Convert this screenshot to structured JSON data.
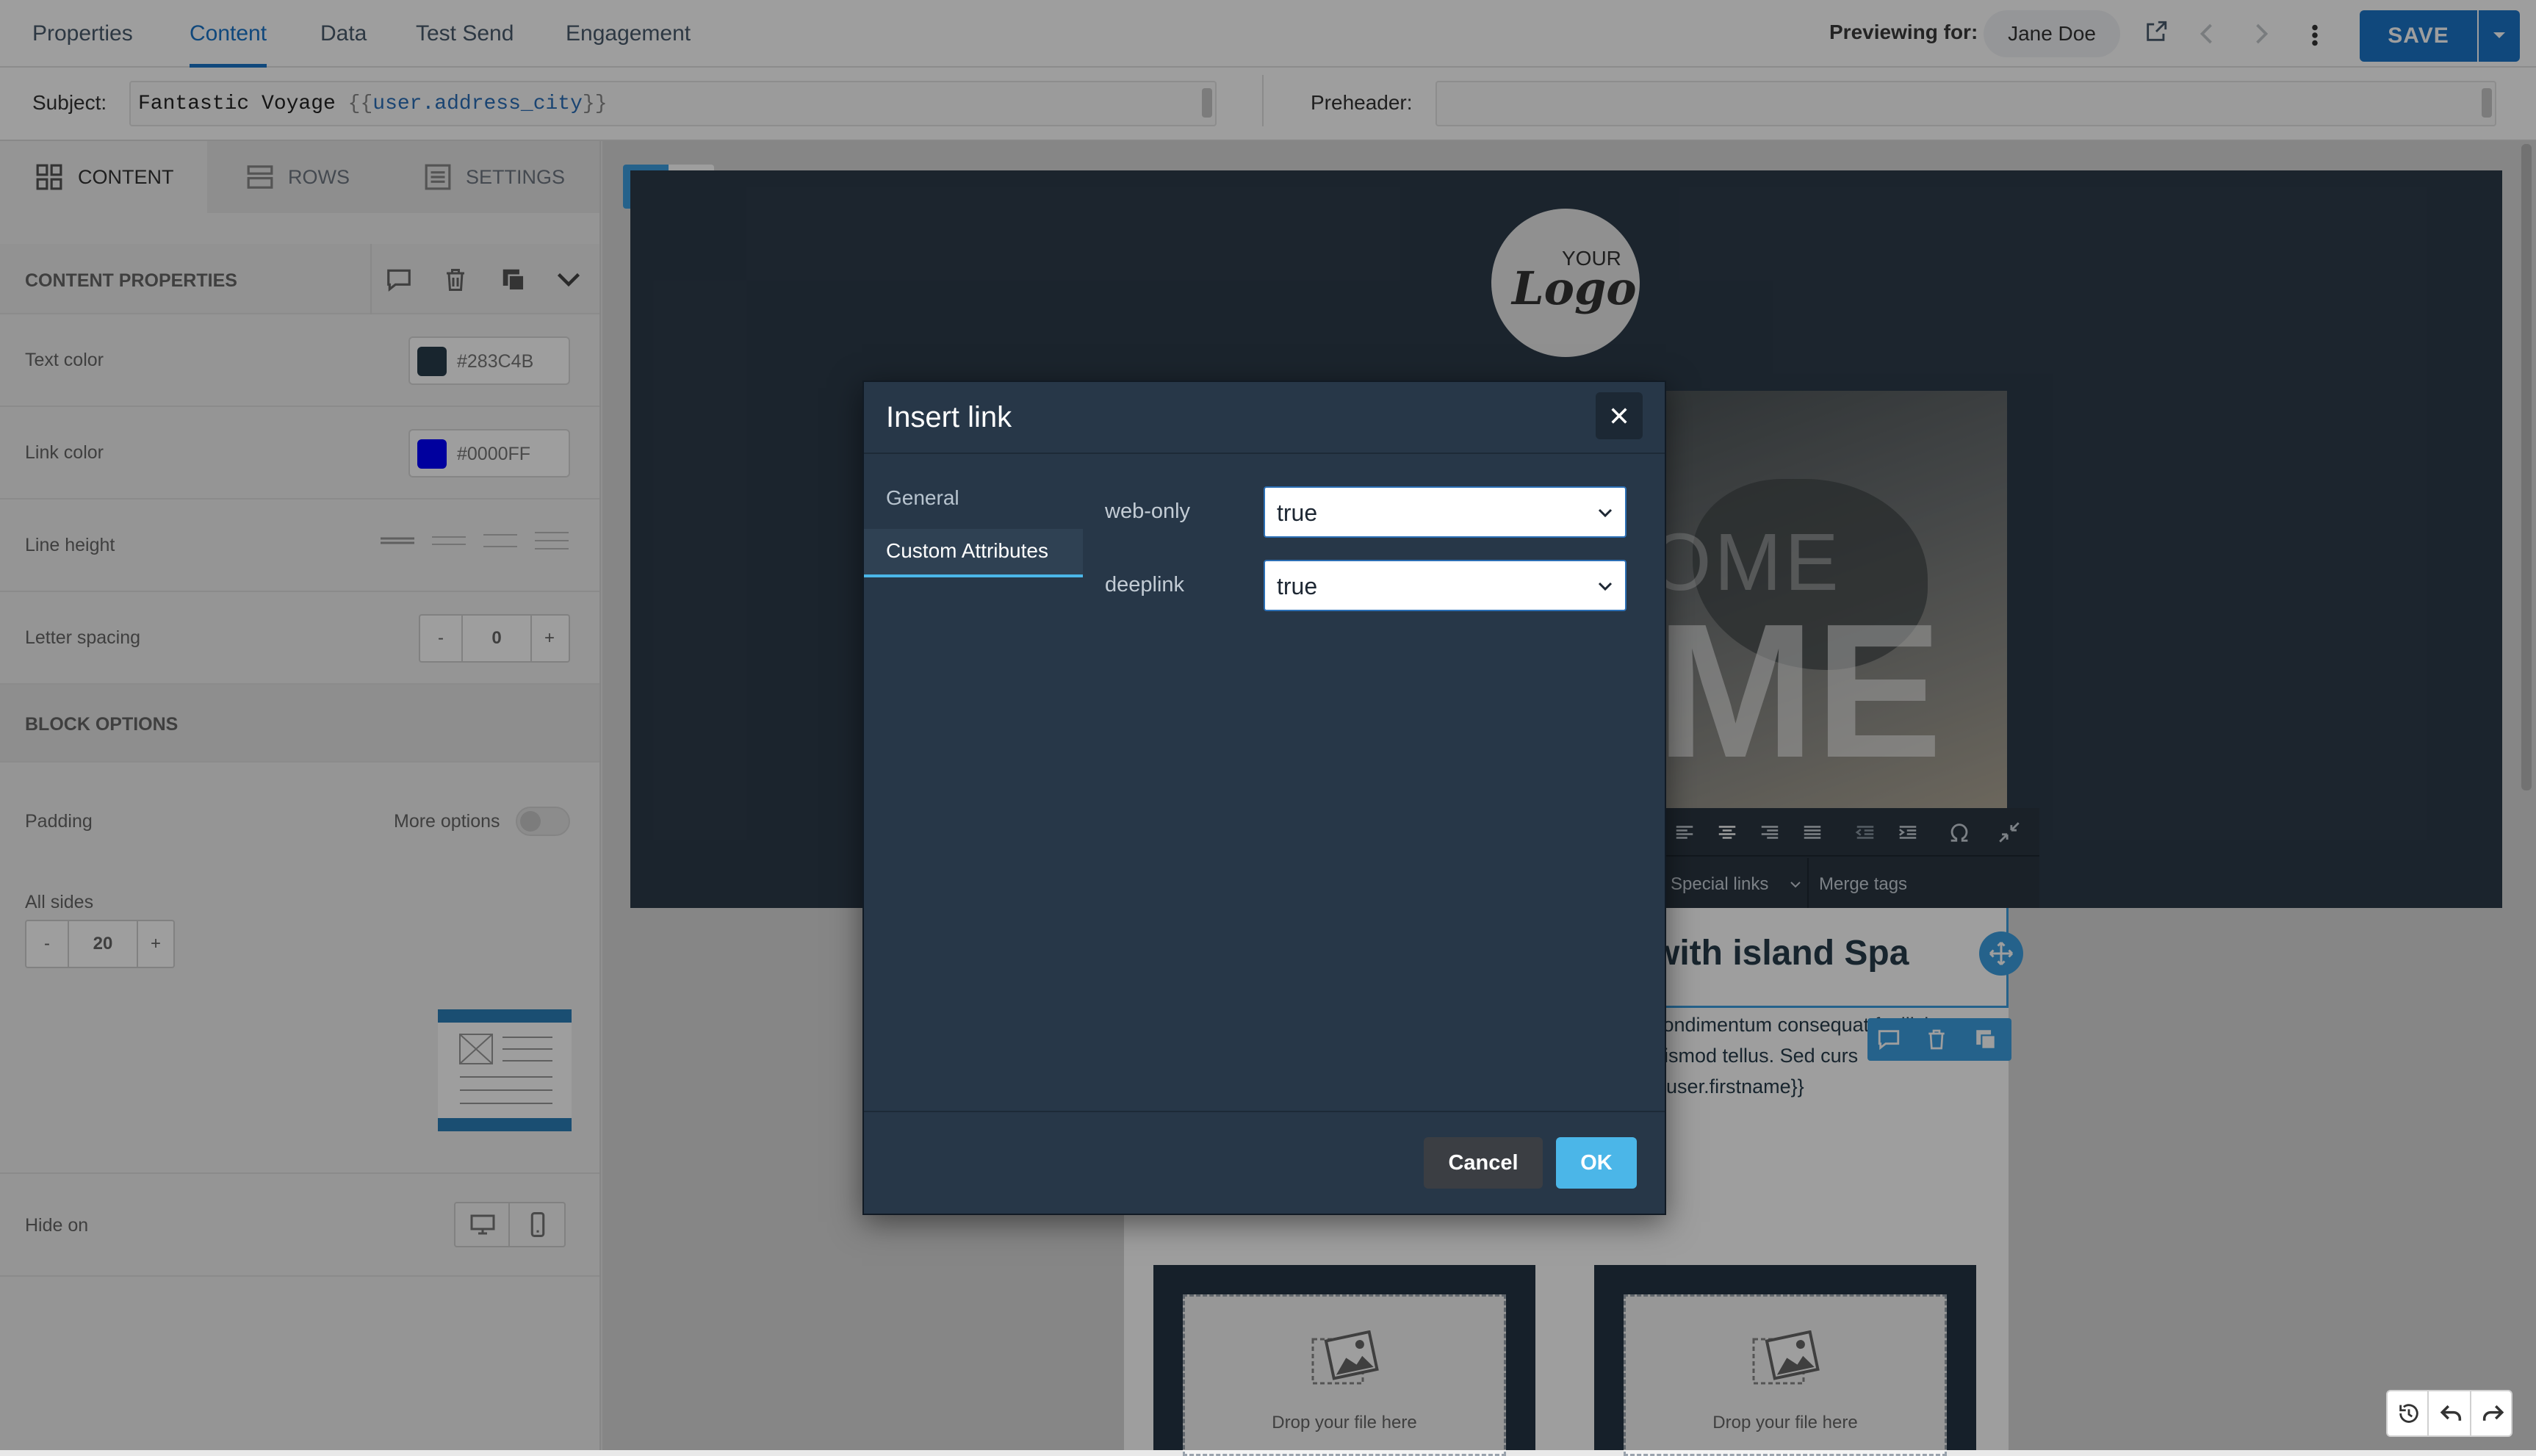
{
  "nav": {
    "tabs": [
      {
        "label": "Properties"
      },
      {
        "label": "Content"
      },
      {
        "label": "Data"
      },
      {
        "label": "Test Send"
      },
      {
        "label": "Engagement"
      }
    ],
    "active_tab": "Content",
    "previewing_label": "Previewing for:",
    "preview_user": "Jane Doe",
    "save_label": "SAVE"
  },
  "subject": {
    "label": "Subject:",
    "value_prefix": "Fantastic Voyage ",
    "value_open": "{{",
    "value_var": "user.address_city",
    "value_close": "}}",
    "preheader_label": "Preheader:",
    "preheader_value": ""
  },
  "left_panel": {
    "tabs": [
      {
        "label": "CONTENT"
      },
      {
        "label": "ROWS"
      },
      {
        "label": "SETTINGS"
      }
    ],
    "content_properties_title": "CONTENT PROPERTIES",
    "text_color_label": "Text color",
    "text_color_value": "#283C4B",
    "link_color_label": "Link color",
    "link_color_value": "#0000FF",
    "line_height_label": "Line height",
    "letter_spacing_label": "Letter spacing",
    "letter_spacing_value": "0",
    "block_options_title": "BLOCK OPTIONS",
    "padding_label": "Padding",
    "more_options_label": "More options",
    "all_sides_label": "All sides",
    "all_sides_value": "20",
    "minus": "-",
    "plus": "+",
    "hide_on_label": "Hide on"
  },
  "canvas": {
    "logo_small": "YOUR",
    "logo_big": "Logo",
    "hero_text_1": "OME",
    "hero_text_2": "ME",
    "special_links": "Special links",
    "merge_tags": "Merge tags",
    "heading": "with island Spa",
    "body_line_1": "condimentum consequat facilisi",
    "body_line_2": "uismod tellus. Sed curs",
    "body_line_3": "{{user.firstname}}",
    "drop_label_1": "Drop your file here",
    "drop_label_2": "Drop your file here"
  },
  "modal": {
    "title": "Insert link",
    "tabs": [
      {
        "label": "General"
      },
      {
        "label": "Custom Attributes"
      }
    ],
    "active_tab": "Custom Attributes",
    "attributes": [
      {
        "name": "web-only",
        "value": "true"
      },
      {
        "name": "deeplink",
        "value": "true"
      }
    ],
    "cancel_label": "Cancel",
    "ok_label": "OK"
  },
  "colors": {
    "accent": "#1a74c9",
    "modal_bg": "#273748",
    "ok_button": "#4bb6e8",
    "cancel_button": "#3b3e43",
    "text_color_swatch": "#283C4B",
    "link_color_swatch": "#0000FF"
  }
}
